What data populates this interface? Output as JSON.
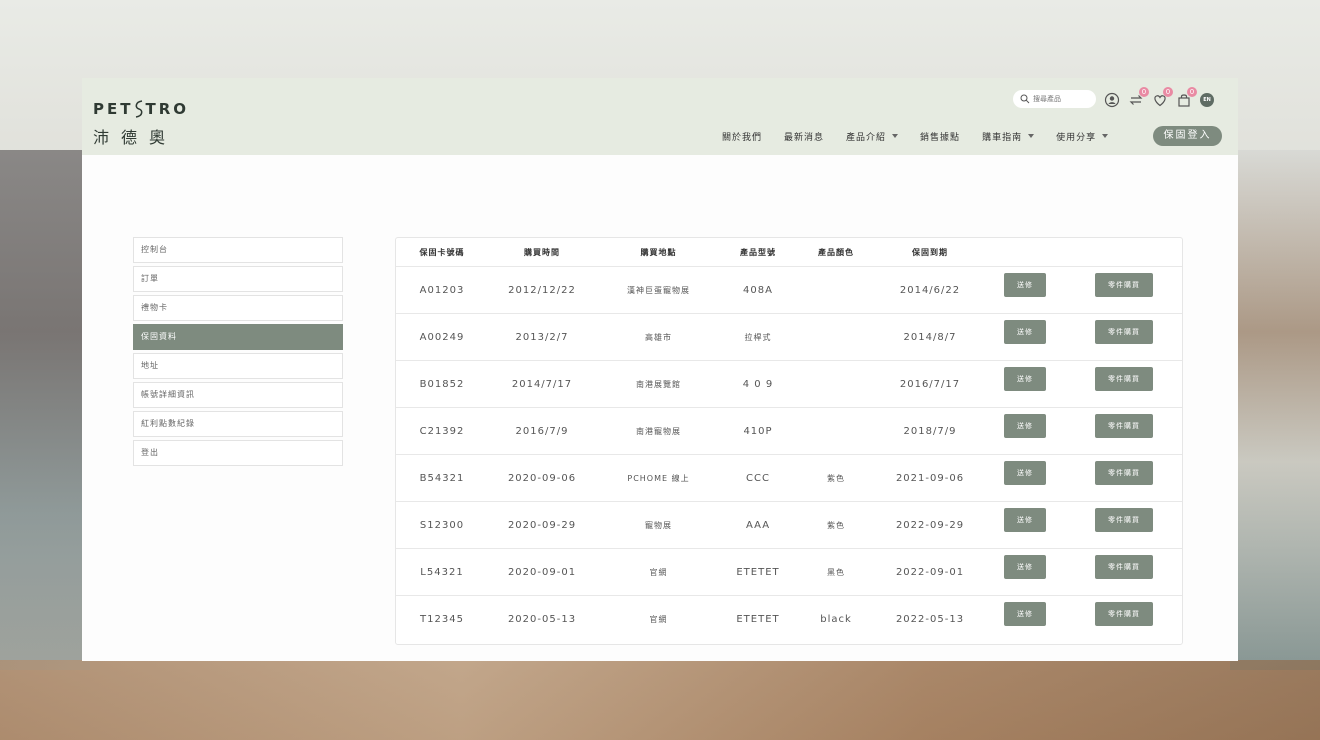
{
  "brand": {
    "logo_en_left": "PET",
    "logo_en_right": "TRO",
    "logo_zh": "沛德奧"
  },
  "search": {
    "placeholder": "搜尋產品"
  },
  "badges": {
    "compare": "0",
    "wishlist": "0",
    "cart": "0"
  },
  "lang": "EN",
  "nav": {
    "items": [
      {
        "label": "關於我們"
      },
      {
        "label": "最新消息"
      },
      {
        "label": "產品介紹"
      },
      {
        "label": "銷售據點"
      },
      {
        "label": "購車指南"
      },
      {
        "label": "使用分享"
      }
    ],
    "login": "保固登入"
  },
  "sidebar": {
    "items": [
      {
        "label": "控制台"
      },
      {
        "label": "訂單"
      },
      {
        "label": "禮物卡"
      },
      {
        "label": "保固資料"
      },
      {
        "label": "地址"
      },
      {
        "label": "帳號詳細資訊"
      },
      {
        "label": "紅利點數紀錄"
      },
      {
        "label": "登出"
      }
    ]
  },
  "table": {
    "headers": [
      "保固卡號碼",
      "購買時間",
      "購買地點",
      "產品型號",
      "產品顏色",
      "保固到期"
    ],
    "repair_label": "送修",
    "parts_label": "零件購買",
    "rows": [
      {
        "card": "A01203",
        "date": "2012/12/22",
        "place": "漢神巨蛋寵物展",
        "model": "408A",
        "color": "",
        "expire": "2014/6/22"
      },
      {
        "card": "A00249",
        "date": "2013/2/7",
        "place": "高雄市",
        "model": "拉桿式",
        "color": "",
        "expire": "2014/8/7"
      },
      {
        "card": "B01852",
        "date": "2014/7/17",
        "place": "南港展覽館",
        "model": "4 0 9",
        "color": "",
        "expire": "2016/7/17"
      },
      {
        "card": "C21392",
        "date": "2016/7/9",
        "place": "南港寵物展",
        "model": "410P",
        "color": "",
        "expire": "2018/7/9"
      },
      {
        "card": "B54321",
        "date": "2020-09-06",
        "place": "PCHOME 線上",
        "model": "CCC",
        "color": "紫色",
        "expire": "2021-09-06"
      },
      {
        "card": "S12300",
        "date": "2020-09-29",
        "place": "寵物展",
        "model": "AAA",
        "color": "紫色",
        "expire": "2022-09-29"
      },
      {
        "card": "L54321",
        "date": "2020-09-01",
        "place": "官網",
        "model": "ETETET",
        "color": "黑色",
        "expire": "2022-09-01"
      },
      {
        "card": "T12345",
        "date": "2020-05-13",
        "place": "官網",
        "model": "ETETET",
        "color": "black",
        "expire": "2022-05-13"
      }
    ]
  }
}
